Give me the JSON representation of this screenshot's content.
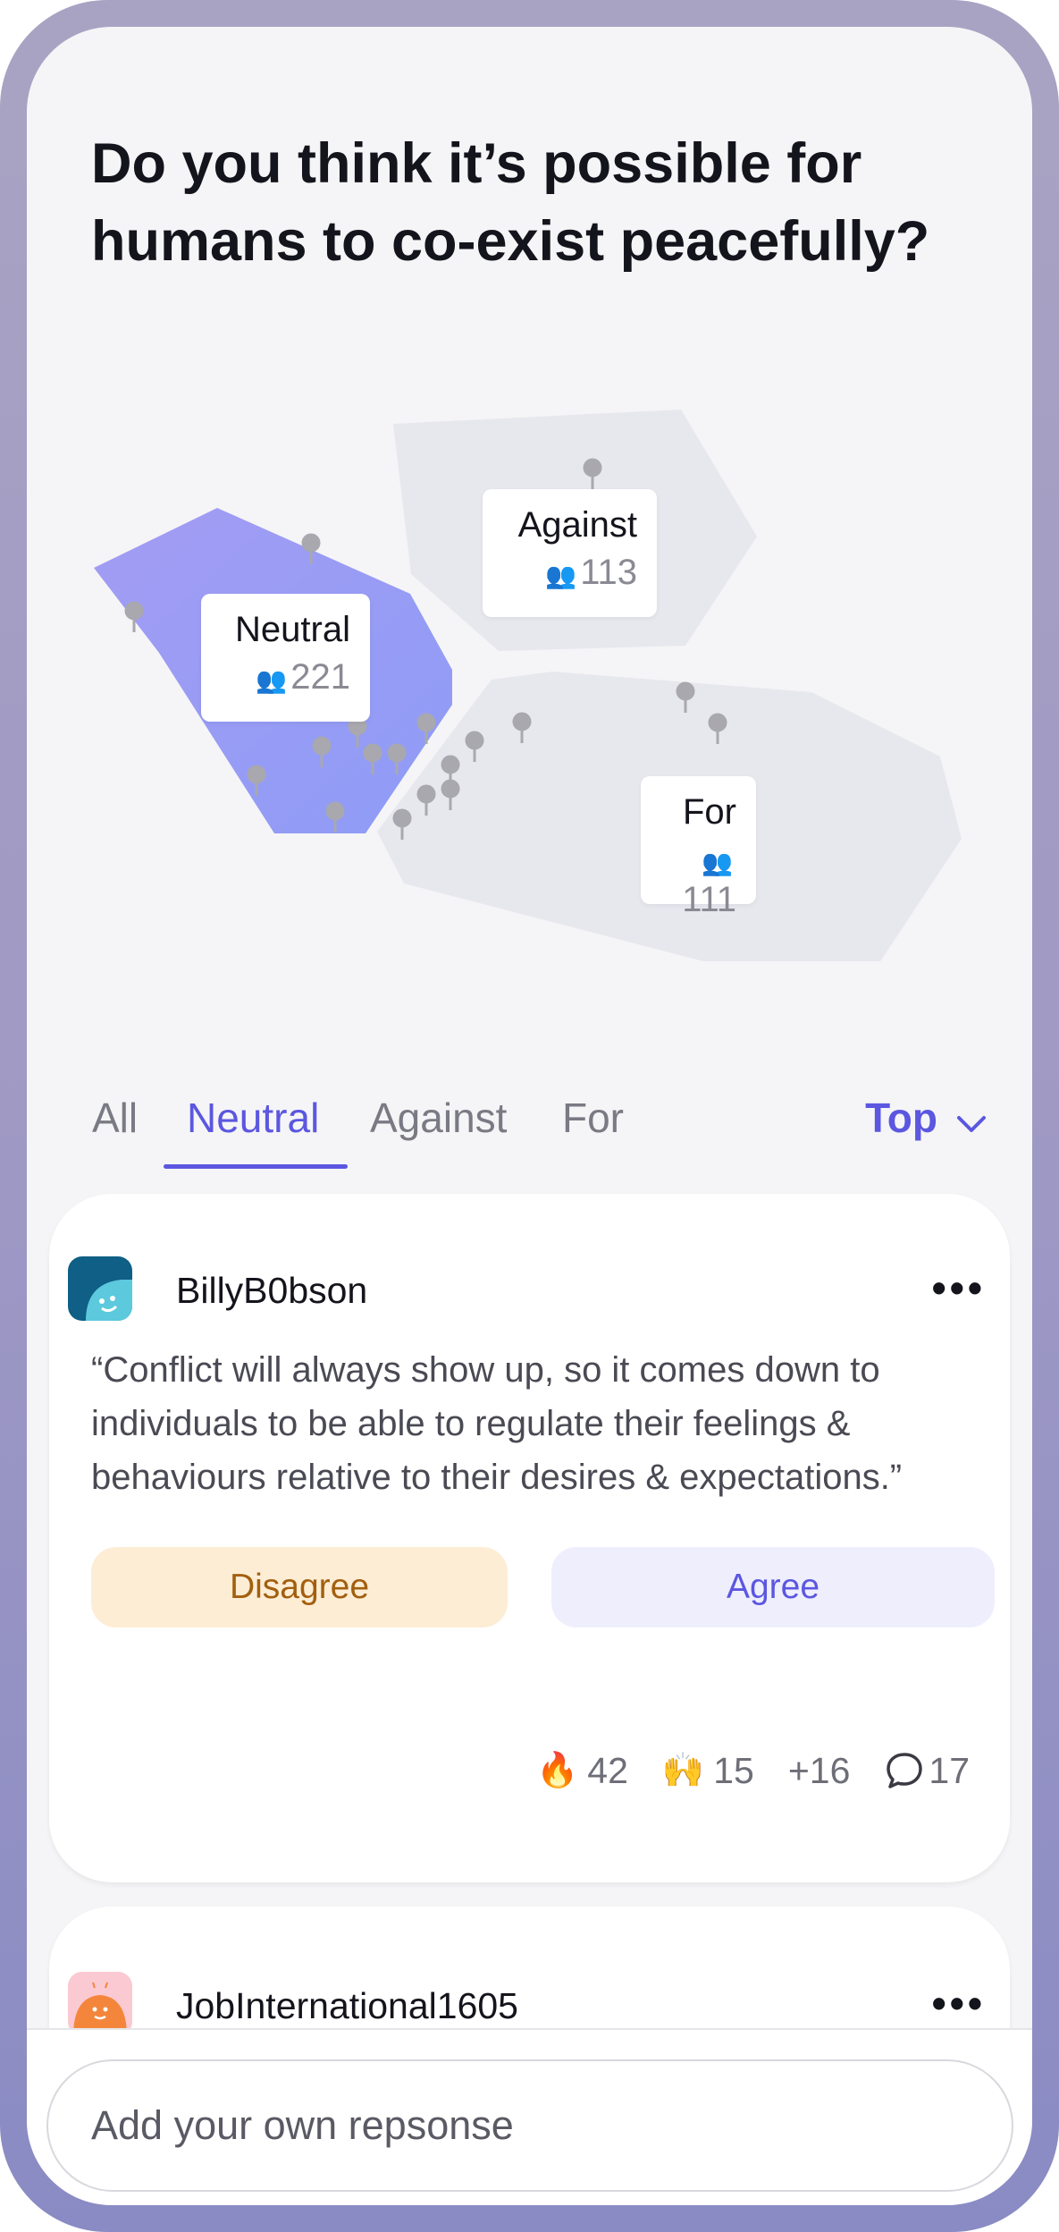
{
  "question": "Do you think it’s possible for humans to co-exist peacefully?",
  "clusters": [
    {
      "name": "Neutral",
      "count": "221"
    },
    {
      "name": "Against",
      "count": "113"
    },
    {
      "name": "For",
      "count": "111"
    }
  ],
  "tabs": [
    "All",
    "Neutral",
    "Against",
    "For"
  ],
  "active_tab": "Neutral",
  "sort_label": "Top",
  "posts": [
    {
      "username": "BillyB0bson",
      "text": "“Conflict will always show up, so it comes down to individuals to be able to regulate their feelings & behaviours relative to their desires & expectations.”",
      "disagree_label": "Disagree",
      "agree_label": "Agree",
      "reactions": [
        {
          "emoji": "🔥",
          "count": "42"
        },
        {
          "emoji": "🙌",
          "count": "15"
        }
      ],
      "more_reactions": "+16",
      "comments": "17"
    },
    {
      "username": "JobInternational1605"
    }
  ],
  "input": {
    "placeholder": "Add your own repsonse"
  },
  "colors": {
    "accent": "#5b57e0",
    "neutral_region": "#9b97f5",
    "other_region": "#e8e8ef",
    "disagree_bg": "#fdedd5",
    "agree_bg": "#efeefd"
  }
}
